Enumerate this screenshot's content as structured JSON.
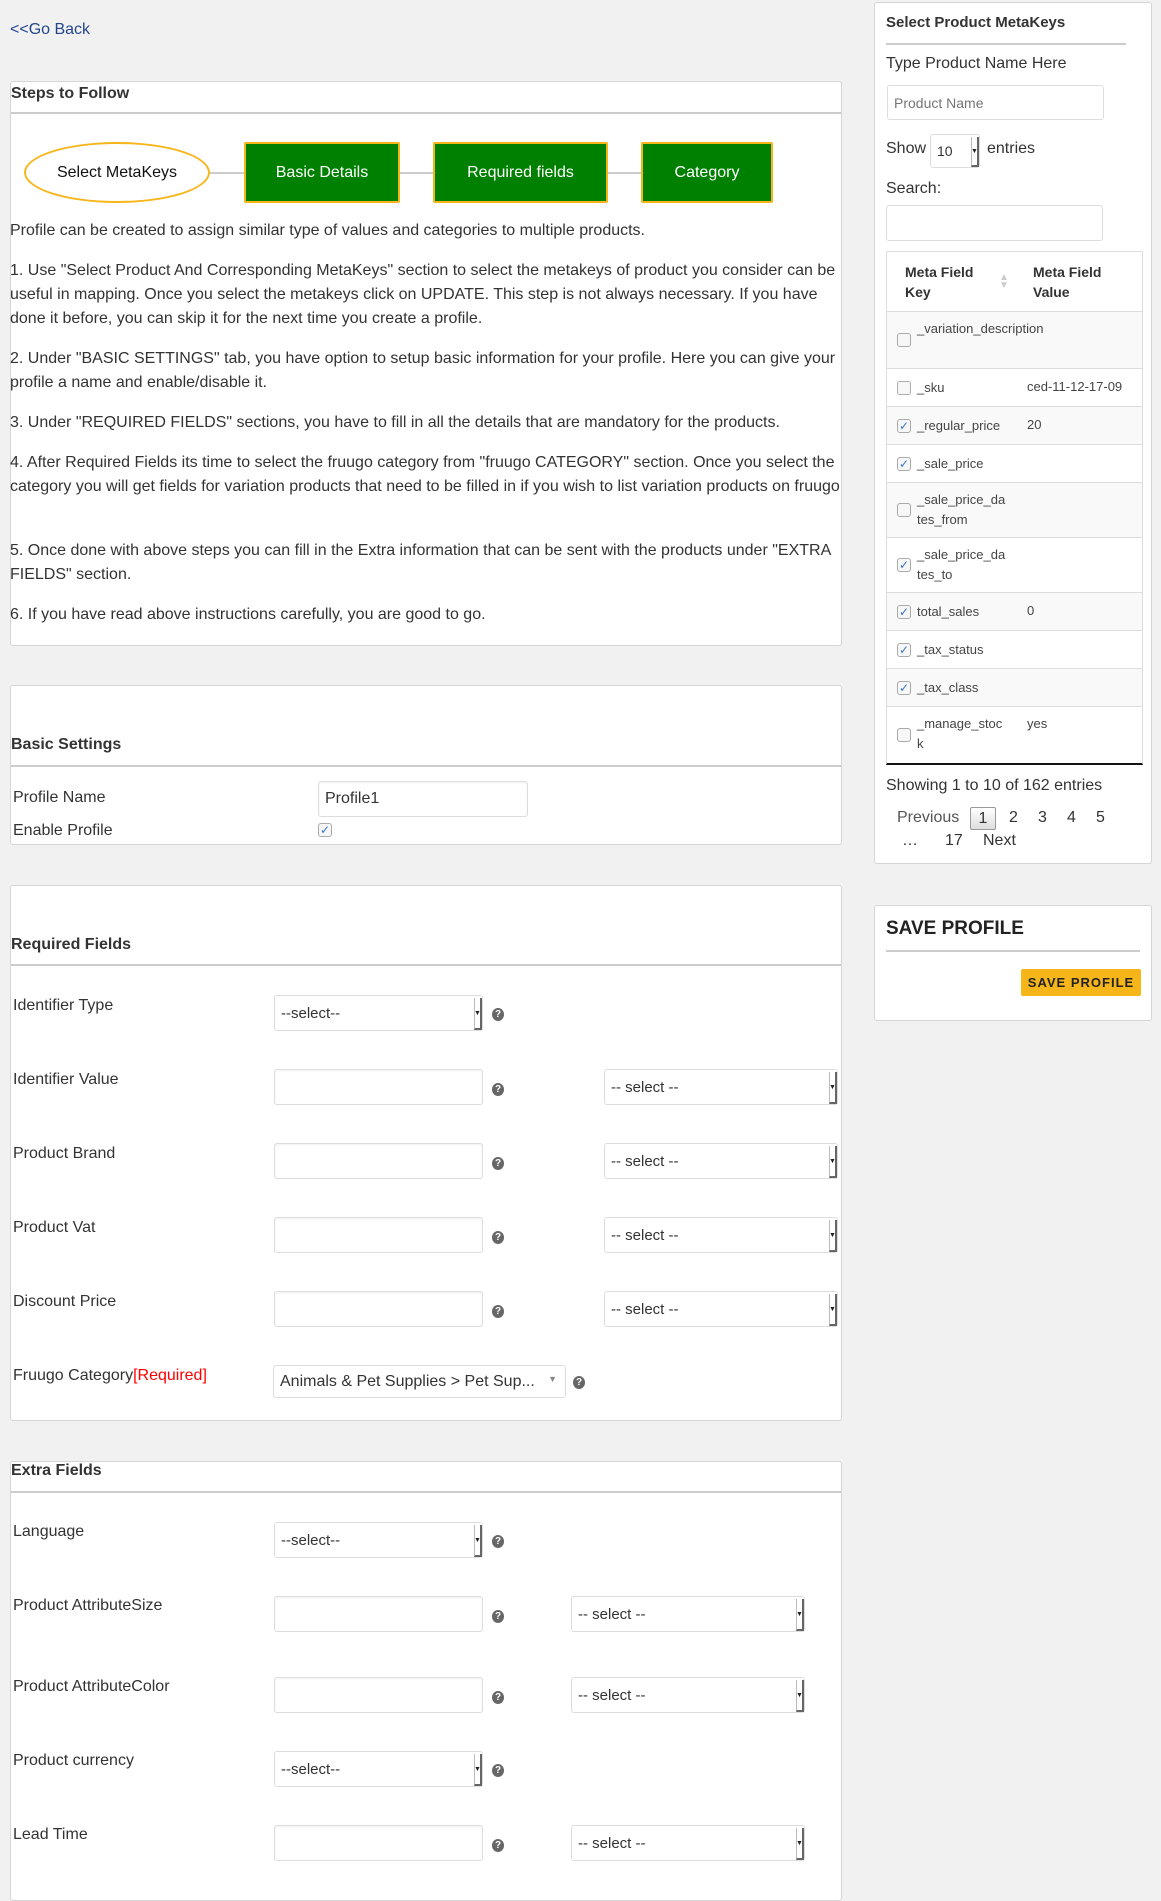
{
  "go_back": "<<Go Back",
  "steps": {
    "title": "Steps to Follow",
    "items": [
      "Select MetaKeys",
      "Basic Details",
      "Required fields",
      "Category"
    ],
    "intro": "Profile can be created to assign similar type of values and categories to multiple products.",
    "instructions": [
      "1. Use \"Select Product And Corresponding MetaKeys\" section to select the metakeys of product you consider can be useful in mapping. Once you select the metakeys click on UPDATE. This step is not always necessary. If you have done it before, you can skip it for the next time you create a profile.",
      "2. Under \"BASIC SETTINGS\" tab, you have option to setup basic information for your profile. Here you can give your profile a name and enable/disable it.",
      "3. Under \"REQUIRED FIELDS\" sections, you have to fill in all the details that are mandatory for the products.",
      "4. After Required Fields its time to select the fruugo category from \"fruugo CATEGORY\" section. Once you select the category you will get fields for variation products that need to be filled in if you wish to list variation products on fruugo",
      "5. Once done with above steps you can fill in the Extra information that can be sent with the products under \"EXTRA FIELDS\" section.",
      "6. If you have read above instructions carefully, you are good to go."
    ]
  },
  "basic": {
    "title": "Basic Settings",
    "profile_name_label": "Profile Name",
    "profile_name_value": "Profile1",
    "enable_label": "Enable Profile",
    "enabled": true
  },
  "required": {
    "title": "Required Fields",
    "identifier_type": {
      "label": "Identifier Type",
      "value": "--select--"
    },
    "rows": [
      {
        "label": "Identifier Value",
        "value": "",
        "select": "-- select --"
      },
      {
        "label": "Product Brand",
        "value": "",
        "select": "-- select --"
      },
      {
        "label": "Product Vat",
        "value": "",
        "select": "-- select --"
      },
      {
        "label": "Discount Price",
        "value": "",
        "select": "-- select --"
      }
    ],
    "category": {
      "label": "Fruugo Category",
      "required": "[Required]",
      "value": "Animals & Pet Supplies > Pet Sup..."
    }
  },
  "extra": {
    "title": "Extra Fields",
    "language": {
      "label": "Language",
      "value": "--select--"
    },
    "size": {
      "label": "Product AttributeSize",
      "value": "",
      "select": "-- select --"
    },
    "color": {
      "label": "Product AttributeColor",
      "value": "",
      "select": "-- select --"
    },
    "currency": {
      "label": "Product currency",
      "value": "--select--"
    },
    "lead": {
      "label": "Lead Time",
      "value": "",
      "select": "-- select --"
    }
  },
  "sidebar": {
    "title": "Select Product MetaKeys",
    "type_label": "Type Product Name Here",
    "product_placeholder": "Product Name",
    "show": "Show",
    "entries_value": "10",
    "entries": "entries",
    "search_label": "Search:",
    "col_key": "Meta Field Key",
    "col_value": "Meta Field Value",
    "rows": [
      {
        "key": "_variation_description",
        "value": "",
        "checked": false
      },
      {
        "key": "_sku",
        "value": "ced-11-12-17-09",
        "checked": false
      },
      {
        "key": "_regular_price",
        "value": "20",
        "checked": true
      },
      {
        "key": "_sale_price",
        "value": "",
        "checked": true
      },
      {
        "key": "_sale_price_dates_from",
        "value": "",
        "checked": false
      },
      {
        "key": "_sale_price_dates_to",
        "value": "",
        "checked": true
      },
      {
        "key": "total_sales",
        "value": "0",
        "checked": true
      },
      {
        "key": "_tax_status",
        "value": "",
        "checked": true
      },
      {
        "key": "_tax_class",
        "value": "",
        "checked": true
      },
      {
        "key": "_manage_stock",
        "value": "yes",
        "checked": false
      }
    ],
    "info": "Showing 1 to 10 of 162 entries",
    "pagination": {
      "previous": "Previous",
      "pages": [
        "1",
        "2",
        "3",
        "4",
        "5"
      ],
      "ellipsis": "…",
      "last": "17",
      "next": "Next"
    }
  },
  "save": {
    "title": "SAVE PROFILE",
    "button": "SAVE PROFILE"
  },
  "colors": {
    "step_green": "#008000",
    "step_border": "#f6b519",
    "save_button": "#f6b519",
    "required_red": "#ff0000",
    "link": "#23468c"
  }
}
